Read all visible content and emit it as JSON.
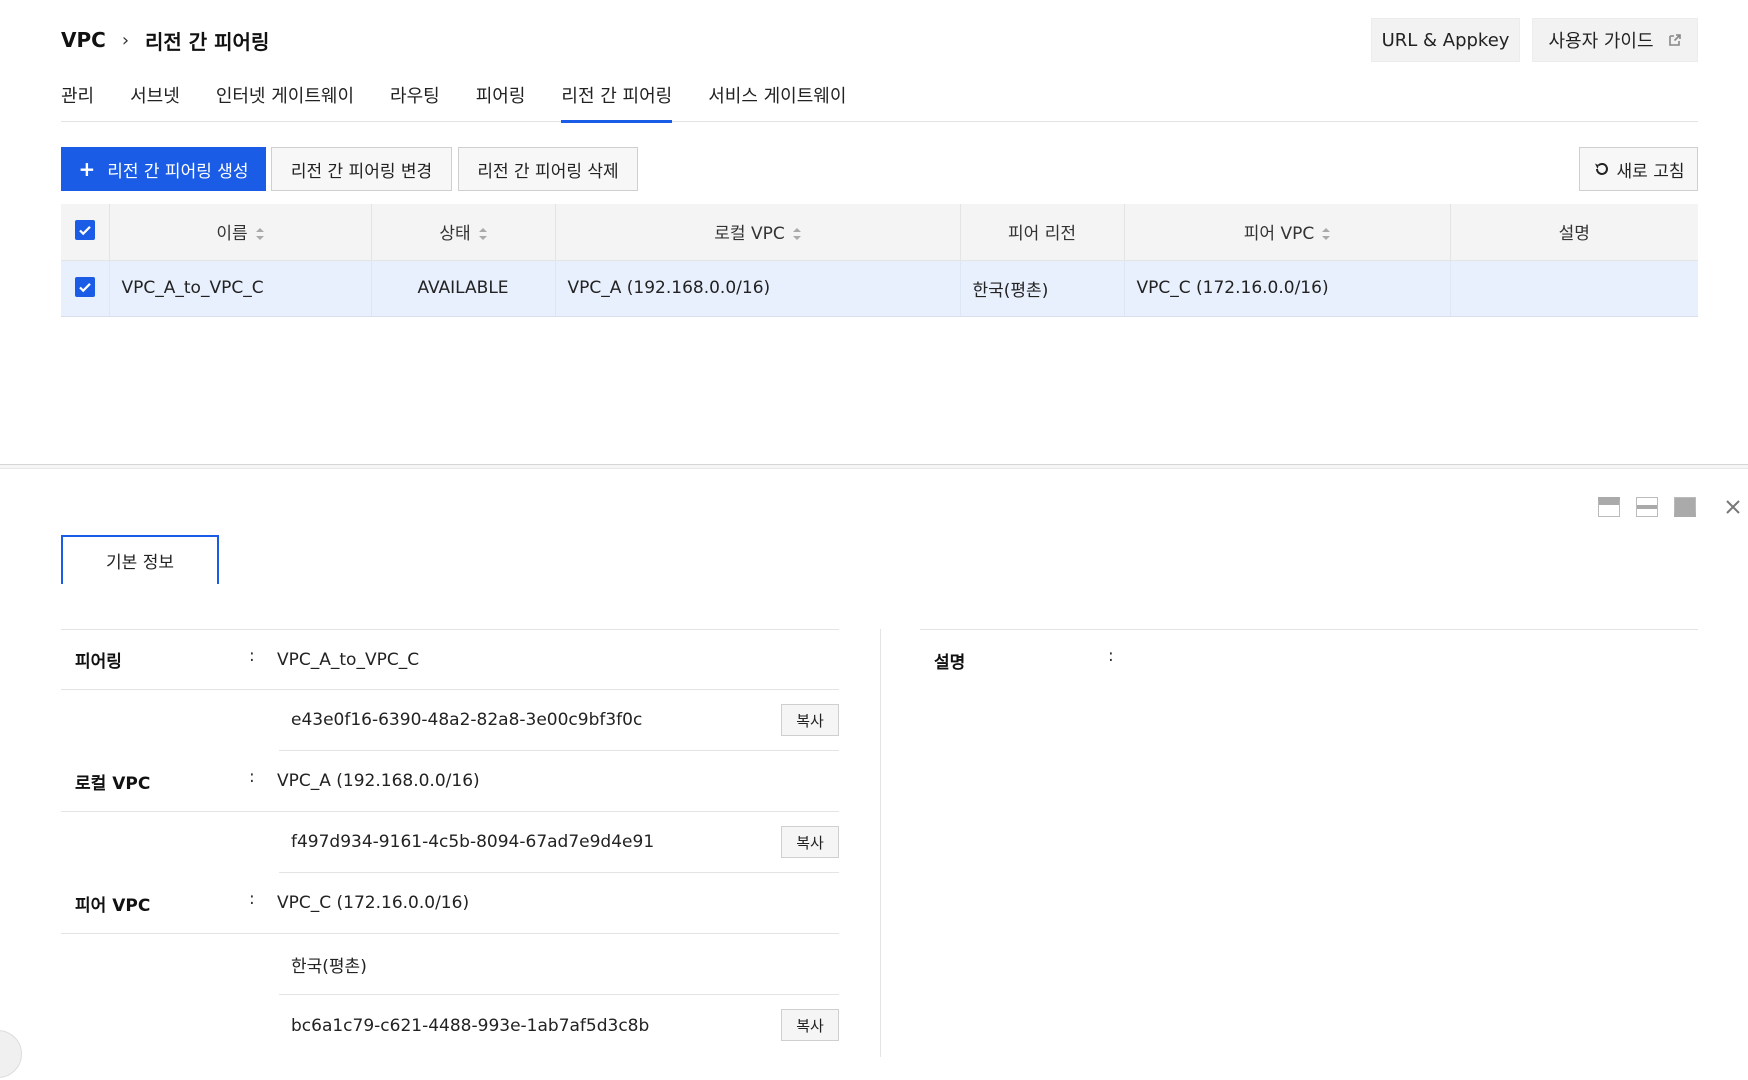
{
  "breadcrumb": {
    "root": "VPC",
    "current": "리전 간 피어링"
  },
  "header_buttons": {
    "url_appkey": "URL & Appkey",
    "user_guide": "사용자 가이드"
  },
  "tabs": [
    {
      "label": "관리",
      "active": false
    },
    {
      "label": "서브넷",
      "active": false
    },
    {
      "label": "인터넷 게이트웨이",
      "active": false
    },
    {
      "label": "라우팅",
      "active": false
    },
    {
      "label": "피어링",
      "active": false
    },
    {
      "label": "리전 간 피어링",
      "active": true
    },
    {
      "label": "서비스 게이트웨이",
      "active": false
    }
  ],
  "actions": {
    "create": "리전 간 피어링 생성",
    "modify": "리전 간 피어링 변경",
    "delete": "리전 간 피어링 삭제",
    "refresh": "새로 고침"
  },
  "table": {
    "headers": {
      "name": "이름",
      "status": "상태",
      "local_vpc": "로컬 VPC",
      "peer_region": "피어 리전",
      "peer_vpc": "피어 VPC",
      "description": "설명"
    },
    "rows": [
      {
        "name": "VPC_A_to_VPC_C",
        "status": "AVAILABLE",
        "local_vpc": "VPC_A (192.168.0.0/16)",
        "peer_region": "한국(평촌)",
        "peer_vpc": "VPC_C (172.16.0.0/16)",
        "description": ""
      }
    ]
  },
  "detail": {
    "tab_label": "기본 정보",
    "colon": ":",
    "copy_label": "복사",
    "peering": {
      "label": "피어링",
      "name": "VPC_A_to_VPC_C",
      "id": "e43e0f16-6390-48a2-82a8-3e00c9bf3f0c"
    },
    "local_vpc": {
      "label": "로컬 VPC",
      "name": "VPC_A (192.168.0.0/16)",
      "id": "f497d934-9161-4c5b-8094-67ad7e9d4e91"
    },
    "peer_vpc": {
      "label": "피어 VPC",
      "name": "VPC_C (172.16.0.0/16)",
      "region": "한국(평촌)",
      "id": "bc6a1c79-c621-4488-993e-1ab7af5d3c8b"
    },
    "description": {
      "label": "설명",
      "value": ""
    }
  },
  "colors": {
    "accent": "#1a5ce6",
    "selected_row": "#e8f0fd"
  }
}
